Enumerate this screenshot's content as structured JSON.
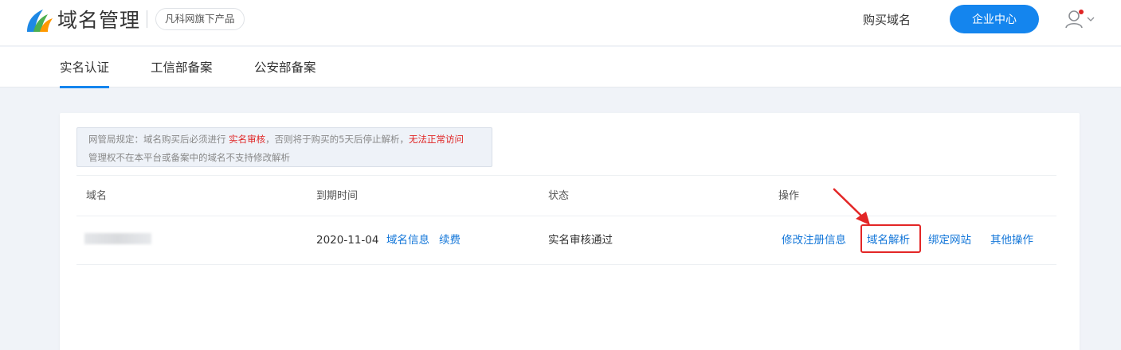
{
  "header": {
    "brand": "域名管理",
    "tag": "凡科网旗下产品",
    "buy_domain": "购买域名",
    "enterprise_center": "企业中心",
    "notification_dot_color": "#e02424",
    "accent_color": "#1485ee"
  },
  "tabs": [
    {
      "label": "实名认证",
      "active": true
    },
    {
      "label": "工信部备案",
      "active": false
    },
    {
      "label": "公安部备案",
      "active": false
    }
  ],
  "notice": {
    "line1_prefix": "网管局规定：域名购买后必须进行",
    "line1_highlight1": "实名审核",
    "line1_middle": "，否则将于购买的5天后停止解析，",
    "line1_highlight2": "无法正常访问",
    "line2": "管理权不在本平台或备案中的域名不支持修改解析"
  },
  "table": {
    "columns": [
      "域名",
      "到期时间",
      "状态",
      "操作"
    ],
    "rows": [
      {
        "domain": "",
        "expiry": "2020-11-04",
        "expiry_links": [
          "域名信息",
          "续费"
        ],
        "status": "实名审核通过",
        "actions": [
          "修改注册信息",
          "域名解析",
          "绑定网站",
          "其他操作"
        ],
        "highlighted_action": "域名解析"
      }
    ]
  },
  "icons": [
    "brand-logo-icon",
    "user-avatar-icon",
    "chevron-down-icon",
    "red-arrow-annotation-icon"
  ]
}
